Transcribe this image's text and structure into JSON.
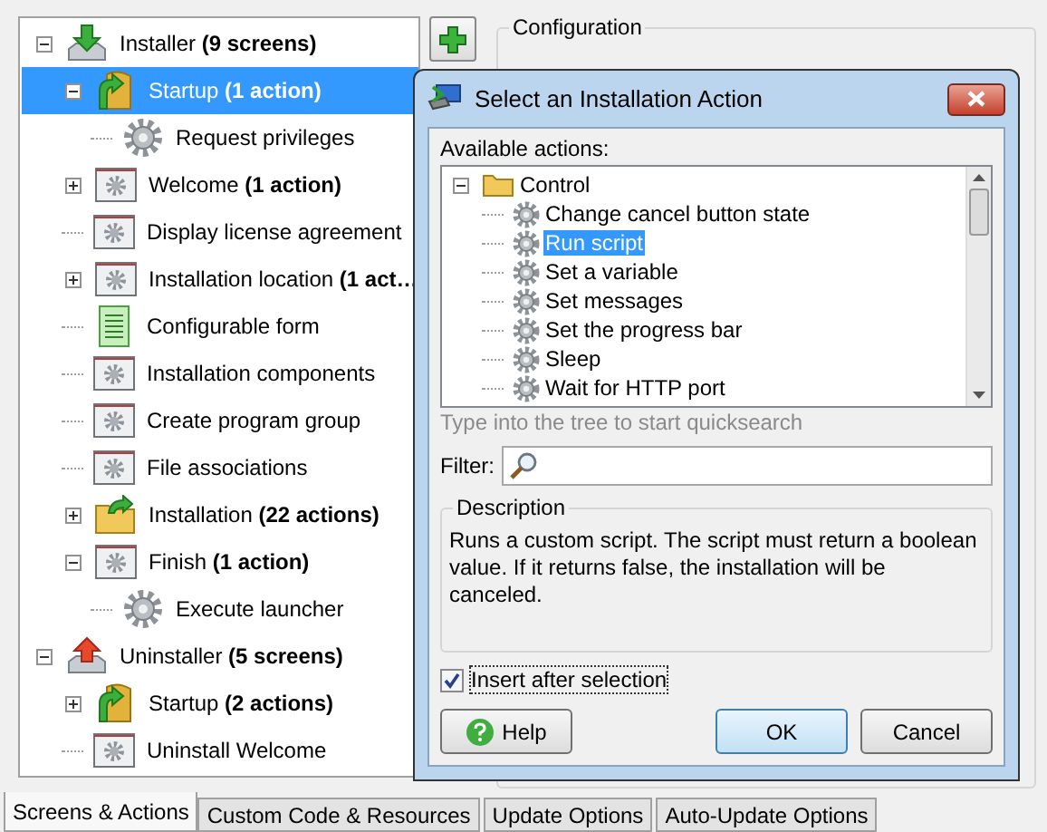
{
  "tree": [
    {
      "label": "Installer **(9 screens)**",
      "kind": "installer",
      "expanded": true,
      "selected": false,
      "children": [
        {
          "label": "Startup **(1 action)**",
          "kind": "startup",
          "expanded": true,
          "selected": true,
          "children": [
            {
              "label": "Request privileges",
              "kind": "action",
              "selected": false
            }
          ]
        },
        {
          "label": "Welcome **(1 action)**",
          "kind": "screen",
          "expanded": false,
          "selected": false
        },
        {
          "label": "Display license agreement",
          "kind": "screen",
          "selected": false
        },
        {
          "label": "Installation location **(1 act…**",
          "kind": "screen",
          "expanded": false,
          "selected": false
        },
        {
          "label": "Configurable form",
          "kind": "form",
          "selected": false
        },
        {
          "label": "Installation components",
          "kind": "screen",
          "selected": false
        },
        {
          "label": "Create program group",
          "kind": "screen",
          "selected": false
        },
        {
          "label": "File associations",
          "kind": "screen",
          "selected": false
        },
        {
          "label": "Installation **(22 actions)**",
          "kind": "installation",
          "expanded": false,
          "selected": false
        },
        {
          "label": "Finish **(1 action)**",
          "kind": "screen",
          "expanded": true,
          "selected": false,
          "children": [
            {
              "label": "Execute launcher",
              "kind": "action",
              "selected": false
            }
          ]
        }
      ]
    },
    {
      "label": "Uninstaller **(5 screens)**",
      "kind": "uninstaller",
      "expanded": true,
      "selected": false,
      "children": [
        {
          "label": "Startup **(2 actions)**",
          "kind": "startup",
          "expanded": false,
          "selected": false
        },
        {
          "label": "Uninstall Welcome",
          "kind": "screen",
          "selected": false
        }
      ]
    }
  ],
  "config": {
    "title": "Configuration"
  },
  "dialog": {
    "title": "Select an Installation Action",
    "actions_label": "Available actions:",
    "actions": [
      {
        "label": "Control",
        "expanded": true,
        "selected": false,
        "children": [
          {
            "label": "Change cancel button state",
            "selected": false
          },
          {
            "label": "Run script",
            "selected": true
          },
          {
            "label": "Set a variable",
            "selected": false
          },
          {
            "label": "Set messages",
            "selected": false
          },
          {
            "label": "Set the progress bar",
            "selected": false
          },
          {
            "label": "Sleep",
            "selected": false
          },
          {
            "label": "Wait for HTTP port",
            "selected": false
          }
        ]
      }
    ],
    "hint": "Type into the tree to start quicksearch",
    "filter_label": "Filter:",
    "description": {
      "title": "Description",
      "text": "Runs a custom script. The script must return a boolean value. If it returns false, the installation will be canceled."
    },
    "insert_after": {
      "label": "Insert after selection",
      "checked": true
    },
    "buttons": [
      {
        "label": "Help",
        "kind": "help",
        "default": false
      },
      {
        "label": "OK",
        "kind": "plain",
        "default": true
      },
      {
        "label": "Cancel",
        "kind": "plain",
        "default": false
      }
    ]
  },
  "tabs": [
    {
      "label": "Screens & Actions",
      "selected": true
    },
    {
      "label": "Custom Code & Resources",
      "selected": false
    },
    {
      "label": "Update Options",
      "selected": false
    },
    {
      "label": "Auto-Update Options",
      "selected": false
    }
  ]
}
